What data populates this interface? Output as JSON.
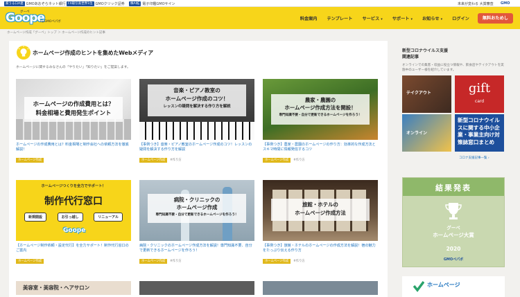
{
  "topbar": {
    "items": [
      {
        "badge": "家うる口A連",
        "text": "GMOあおぞらネット銀行"
      },
      {
        "badge": "FX取引高世界1位",
        "text": "GMOクリック証券"
      },
      {
        "badge": "株AI拡",
        "text": "電子印鑑GMOサイン"
      }
    ],
    "right_text": "未来が変わる 大賞審査",
    "right_brand": "GMO"
  },
  "header": {
    "logo": "Goope",
    "logo_tag": "グーペ",
    "logo_by": "byGMOペパボ",
    "nav": [
      "料金案内",
      "テンプレート",
      "サービス",
      "サポート",
      "お知らせ",
      "ログイン"
    ],
    "nav_caret": "▾",
    "trial_button": "無料おためし"
  },
  "breadcrumb": "ホームページ作成「グーペ」トップ ＞ ホームページ作成のヒント記事",
  "main": {
    "title": "ホームページ作成のヒントを集めたWebメディア",
    "subtitle": "ホームページに関するみなさんの「やりたい」「知りたい」をご提案します。",
    "cards": [
      {
        "overlay_lines": [
          "ホームページの作成費用とは？",
          "料金相場と費用発生ポイント"
        ],
        "title": "ホームページの作成費用とは？料金相場と制作会社への依頼方法を徹底解説！",
        "category": "ホームページ作成",
        "tag": ""
      },
      {
        "overlay_lines": [
          "音楽・ピアノ教室の",
          "ホームページ作成のコツ！",
          "レッスンの疑問を解決する作り方を解説"
        ],
        "title": "【事例つき】音楽・ピアノ教室のホームページ作成のコツ！レッスンの疑問を解決する作り方を解説",
        "category": "ホームページ作成",
        "tag": "#作り方"
      },
      {
        "overlay_lines": [
          "農家・農園の",
          "ホームページ作成方法を開設！",
          "専門知識不要・自分で更新できるホームページを作ろう！"
        ],
        "title": "【事例つき】農家・農園のホームページの作り方：効率的な作成方法とスキマ時間に情報発信するコツ",
        "category": "ホームページ作成",
        "tag": "#作り方"
      },
      {
        "overlay_lines": [
          "ホームページつくりを全力でサポート！",
          "制作代行窓口",
          "新規開設",
          "お引っ越し",
          "リニューアル",
          "Goope"
        ],
        "title": "【ホームページ制作依頼・設定代行】を全力サポート！制作代行窓口のご案内",
        "category": "ホームページ作成",
        "tag": ""
      },
      {
        "overlay_lines": [
          "病院・クリニックの",
          "ホームページ作成",
          "専門知識不要・自分で更新できるホームページを作ろう！"
        ],
        "title": "病院・クリニックのホームページ作成方法を解説！専門知識不要、自分で更新できるホームページを作ろう！",
        "category": "ホームページ作成",
        "tag": "#作り方"
      },
      {
        "overlay_lines": [
          "旅館・ホテルの",
          "ホームページ作成方法"
        ],
        "title": "【事例つき】旅館・ホテルのホームページの作成方法を解説！宿の魅力をたっぷり伝える作り方",
        "category": "ホームページ作成",
        "tag": "#作り方"
      },
      {
        "overlay_lines": [
          "美容室・美容院・ヘアサロン"
        ],
        "title": "",
        "category": "",
        "tag": ""
      }
    ]
  },
  "sidebar": {
    "title": "新型コロナウイルス支援\n関連記事",
    "desc": "オンラインでの集客・収益に役立つ情報や、飲食店やテイクアウトを実施中のユーザー様を紹介しています。",
    "images": [
      {
        "text": "テイクアウト"
      },
      {
        "text": "gift",
        "sub": "card"
      },
      {
        "text": "オンライン"
      },
      {
        "text": "新型コロナウイルスに関する中小企業・事業主向け対策誌窓口まとめ"
      }
    ],
    "more_link": "コロナ支援記事一覧 ›",
    "award": {
      "head": "結果発表",
      "line1": "グーペ",
      "line2": "ホームページ大賞",
      "year": "2020",
      "brand": "GMOペパボ"
    },
    "bottom_text": "ホームページ"
  },
  "colors": {
    "header_yellow": "#f7d51a",
    "link_blue": "#1e73be",
    "trial_red": "#e2573b",
    "category_gold": "#e0b81a"
  }
}
